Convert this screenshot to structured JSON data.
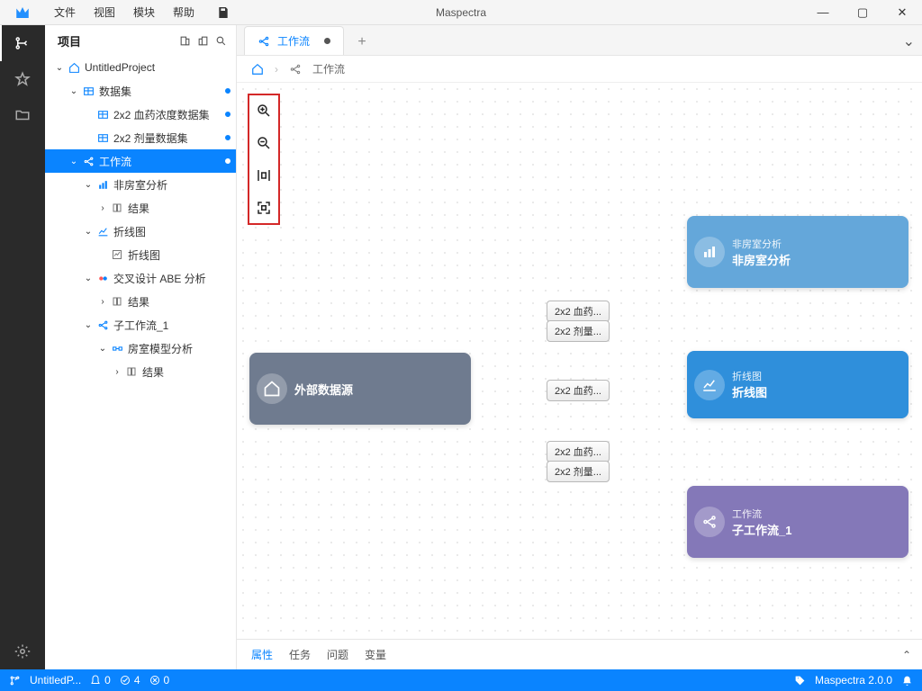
{
  "app_title": "Maspectra",
  "menu": {
    "file": "文件",
    "view": "视图",
    "module": "模块",
    "help": "帮助"
  },
  "sidebar_title": "项目",
  "tree": {
    "project": "UntitledProject",
    "datasets": "数据集",
    "ds1": "2x2 血药浓度数据集",
    "ds2": "2x2 剂量数据集",
    "workflow": "工作流",
    "nca": "非房室分析",
    "results": "结果",
    "lineplot": "折线图",
    "lineplot_item": "折线图",
    "abe": "交叉设计 ABE 分析",
    "abe_results": "结果",
    "subwf": "子工作流_1",
    "compart": "房室模型分析",
    "compart_results": "结果"
  },
  "tab": {
    "title": "工作流"
  },
  "crumb": {
    "wf": "工作流"
  },
  "nodes": {
    "source_title": "外部数据源",
    "nca_sub": "非房室分析",
    "nca_title": "非房室分析",
    "line_sub": "折线图",
    "line_title": "折线图",
    "sub_sub": "工作流",
    "sub_title": "子工作流_1"
  },
  "ports": {
    "blood": "2x2 血药...",
    "dose": "2x2 剂量..."
  },
  "bottom_tabs": {
    "attr": "属性",
    "task": "任务",
    "issue": "问题",
    "var": "变量"
  },
  "status": {
    "project": "UntitledP...",
    "c1": "0",
    "c2": "4",
    "c3": "0",
    "version": "Maspectra 2.0.0"
  }
}
